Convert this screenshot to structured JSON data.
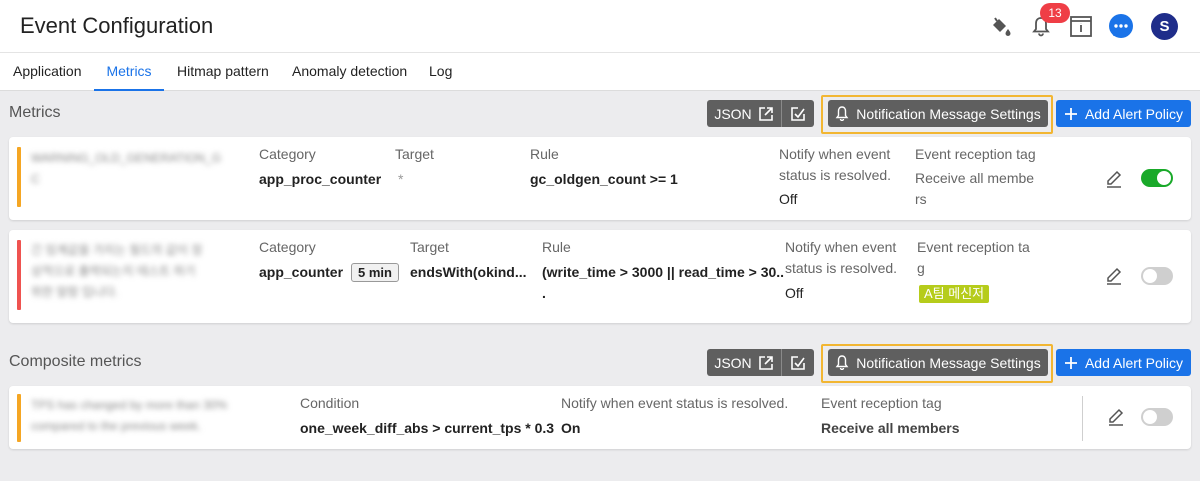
{
  "header": {
    "title": "Event Configuration",
    "notification_count": "13",
    "avatar_initial": "S",
    "icons": [
      "paint-bucket-icon",
      "bell-icon",
      "info-box-icon",
      "chat-icon"
    ]
  },
  "tabs": [
    {
      "label": "Application"
    },
    {
      "label": "Metrics",
      "active": true
    },
    {
      "label": "Hitmap pattern"
    },
    {
      "label": "Anomaly detection"
    },
    {
      "label": "Log"
    }
  ],
  "toolbar": {
    "json_label": "JSON",
    "notification_label": "Notification Message Settings",
    "add_label": "Add Alert Policy"
  },
  "metrics": {
    "title": "Metrics",
    "rows": [
      {
        "name_lines": [
          "WARNING_OLD_GENERATION_G",
          "C"
        ],
        "category_label": "Category",
        "category": "app_proc_counter",
        "target_label": "Target",
        "target": "*",
        "rule_label": "Rule",
        "rule": "gc_oldgen_count >= 1",
        "notify_label_lines": [
          "Notify when event",
          "status is resolved."
        ],
        "notify_value": "Off",
        "tag_label": "Event reception tag",
        "tag_value_lines": [
          "Receive all membe",
          "rs"
        ],
        "enabled": true,
        "stripe_color": "#f5a623"
      },
      {
        "name_lines": [
          "긴 임계값을 가지는 필드의 값이 정",
          "상적으로 출력되는지 테스트 하기",
          "위한 알람 입니다."
        ],
        "category_label": "Category",
        "category": "app_counter",
        "interval": "5 min",
        "target_label": "Target",
        "target": "endsWith(okind...",
        "rule_label": "Rule",
        "rule_lines": [
          "(write_time > 3000 || read_time > 30..",
          "."
        ],
        "notify_label_lines": [
          "Notify when event",
          "status is resolved."
        ],
        "notify_value": "Off",
        "tag_label_lines": [
          "Event reception ta",
          "g"
        ],
        "tag_value": "A팀 메신저",
        "enabled": false,
        "stripe_color": "#ef5350"
      }
    ]
  },
  "composite": {
    "title": "Composite metrics",
    "rows": [
      {
        "name_lines": [
          "TPS has changed by more than 30%",
          "compared to the previous week."
        ],
        "condition_label": "Condition",
        "condition": "one_week_diff_abs > current_tps * 0.3",
        "notify_label": "Notify when event status is resolved.",
        "notify_value": "On",
        "tag_label": "Event reception tag",
        "tag_value": "Receive all members",
        "enabled": false,
        "stripe_color": "#f5a623"
      }
    ]
  },
  "colors": {
    "accent": "#1a73e8",
    "highlight": "#f2b632",
    "toggle_on": "#19a929",
    "badge": "#ef3e46"
  }
}
